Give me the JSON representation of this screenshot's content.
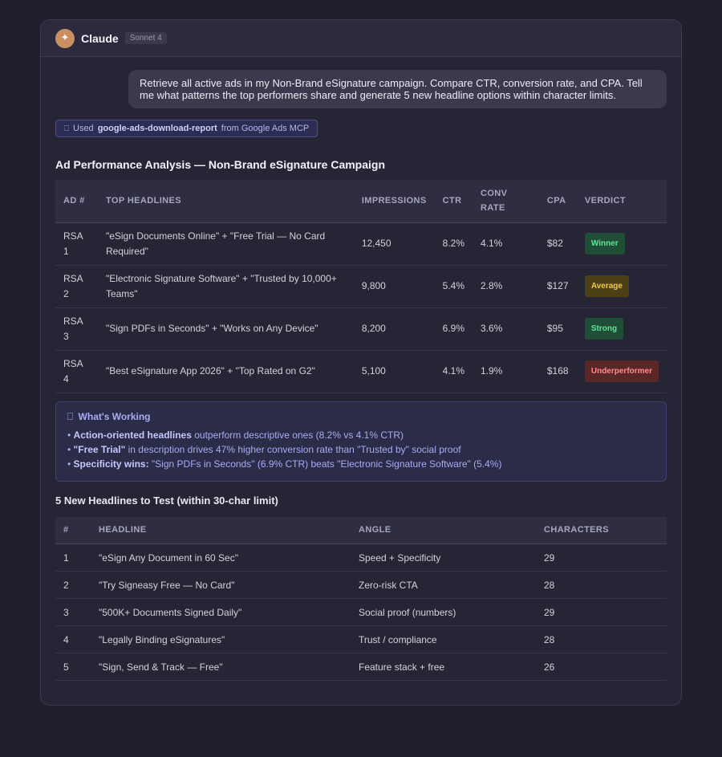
{
  "app": {
    "name": "Claude",
    "model": "Sonnet 4",
    "avatar_glyph": "✦"
  },
  "user_message": "Retrieve all active ads in my Non-Brand eSignature campaign. Compare CTR, conversion rate, and CPA. Tell me what patterns the top performers share and generate 5 new headline options within character limits.",
  "tool_use": {
    "icon": "⎕",
    "prefix": "Used",
    "tool": "google-ads-download-report",
    "suffix": "from Google Ads MCP"
  },
  "analysis_title": "Ad Performance Analysis — Non-Brand eSignature Campaign",
  "perf_table": {
    "headers": [
      "AD #",
      "TOP HEADLINES",
      "IMPRESSIONS",
      "CTR",
      "CONV RATE",
      "CPA",
      "VERDICT"
    ],
    "rows": [
      {
        "ad": "RSA 1",
        "headlines": "\"eSign Documents Online\" + \"Free Trial — No Card Required\"",
        "impressions": "12,450",
        "ctr": "8.2%",
        "conv": "4.1%",
        "cpa": "$82",
        "verdict": "Winner"
      },
      {
        "ad": "RSA 2",
        "headlines": "\"Electronic Signature Software\" + \"Trusted by 10,000+ Teams\"",
        "impressions": "9,800",
        "ctr": "5.4%",
        "conv": "2.8%",
        "cpa": "$127",
        "verdict": "Average"
      },
      {
        "ad": "RSA 3",
        "headlines": "\"Sign PDFs in Seconds\" + \"Works on Any Device\"",
        "impressions": "8,200",
        "ctr": "6.9%",
        "conv": "3.6%",
        "cpa": "$95",
        "verdict": "Strong"
      },
      {
        "ad": "RSA 4",
        "headlines": "\"Best eSignature App 2026\" + \"Top Rated on G2\"",
        "impressions": "5,100",
        "ctr": "4.1%",
        "conv": "1.9%",
        "cpa": "$168",
        "verdict": "Underperformer"
      }
    ]
  },
  "insights": {
    "icon": "⎕",
    "title": "What's Working",
    "items": [
      {
        "bullet": "•",
        "bold": "Action-oriented headlines",
        "rest": " outperform descriptive ones (8.2% vs 4.1% CTR)"
      },
      {
        "bullet": "•",
        "bold": "\"Free Trial\"",
        "rest": " in description drives 47% higher conversion rate than \"Trusted by\" social proof"
      },
      {
        "bullet": "•",
        "bold": "Specificity wins:",
        "rest": " \"Sign PDFs in Seconds\" (6.9% CTR) beats \"Electronic Signature Software\" (5.4%)"
      }
    ]
  },
  "headlines_title": "5 New Headlines to Test (within 30-char limit)",
  "headline_table": {
    "headers": [
      "#",
      "HEADLINE",
      "ANGLE",
      "CHARACTERS"
    ],
    "rows": [
      {
        "num": "1",
        "headline": "\"eSign Any Document in 60 Sec\"",
        "angle": "Speed + Specificity",
        "chars": "29"
      },
      {
        "num": "2",
        "headline": "\"Try Signeasy Free — No Card\"",
        "angle": "Zero-risk CTA",
        "chars": "28"
      },
      {
        "num": "3",
        "headline": "\"500K+ Documents Signed Daily\"",
        "angle": "Social proof (numbers)",
        "chars": "29"
      },
      {
        "num": "4",
        "headline": "\"Legally Binding eSignatures\"",
        "angle": "Trust / compliance",
        "chars": "28"
      },
      {
        "num": "5",
        "headline": "\"Sign, Send & Track — Free\"",
        "angle": "Feature stack + free",
        "chars": "26"
      }
    ]
  },
  "colors": {
    "background": "#201f2e",
    "panel": "#262536",
    "accent": "#a9acf2",
    "winner": "#5fe39a",
    "average": "#f2c94c",
    "underperformer": "#ff8a8a"
  }
}
